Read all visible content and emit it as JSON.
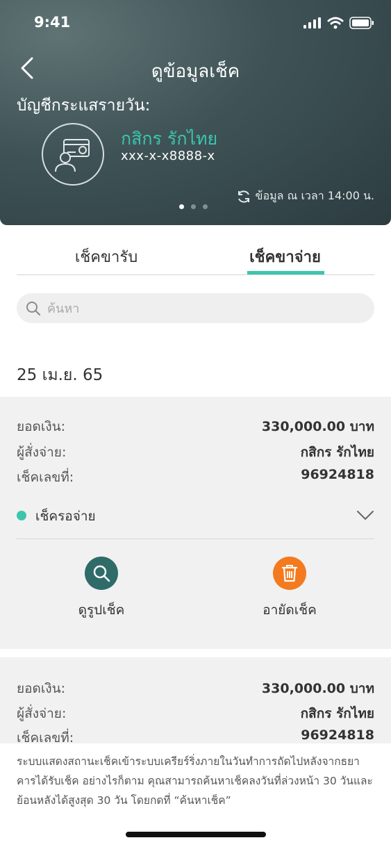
{
  "status_bar": {
    "time": "9:41"
  },
  "header": {
    "title": "ดูข้อมูลเช็ค",
    "account_type": "บัญชีกระแสรายวัน:",
    "account_name": "กสิกร รักไทย",
    "account_number": "xxx-x-x8888-x",
    "data_time": "ข้อมูล ณ เวลา 14:00 น.",
    "page_dots": 3,
    "active_dot": 0
  },
  "tabs": [
    {
      "label": "เช็คขารับ",
      "active": false
    },
    {
      "label": "เช็คขาจ่าย",
      "active": true
    }
  ],
  "search": {
    "placeholder": "ค้นหา"
  },
  "date_heading": "25 เม.ย. 65",
  "checks": [
    {
      "amount_label": "ยอดเงิน:",
      "amount": "330,000.00 บาท",
      "payer_label": "ผู้สั่งจ่าย:",
      "payer": "กสิกร รักไทย",
      "number_label": "เช็คเลขที่:",
      "number": "96924818",
      "status": "เช็ครอจ่าย",
      "status_color": "#3cc5ad",
      "actions": {
        "view_label": "ดูรูปเช็ค",
        "void_label": "อายัดเช็ค"
      }
    },
    {
      "amount_label": "ยอดเงิน:",
      "amount": "330,000.00 บาท",
      "payer_label": "ผู้สั่งจ่าย:",
      "payer": "กสิกร รักไทย",
      "number_label": "เช็คเลขที่:",
      "number": "96924818"
    }
  ],
  "footer_note": "ระบบแสดงสถานะเช็คเข้าระบบเครียร์ริ่งภายในวันทำการถัดไปหลังจากธยาคารได้รับเช็ค อย่างไรก็ตาม คุณสามารถค้นหาเช็คลงวันที่ล่วงหน้า 30 วันและย้อนหลังได้สูงสุด 30 วัน โดยกดที่ “ค้นหาเช็ค”",
  "colors": {
    "accent": "#3cc5ad",
    "view_button": "#2f6b69",
    "void_button": "#f47a1f"
  }
}
